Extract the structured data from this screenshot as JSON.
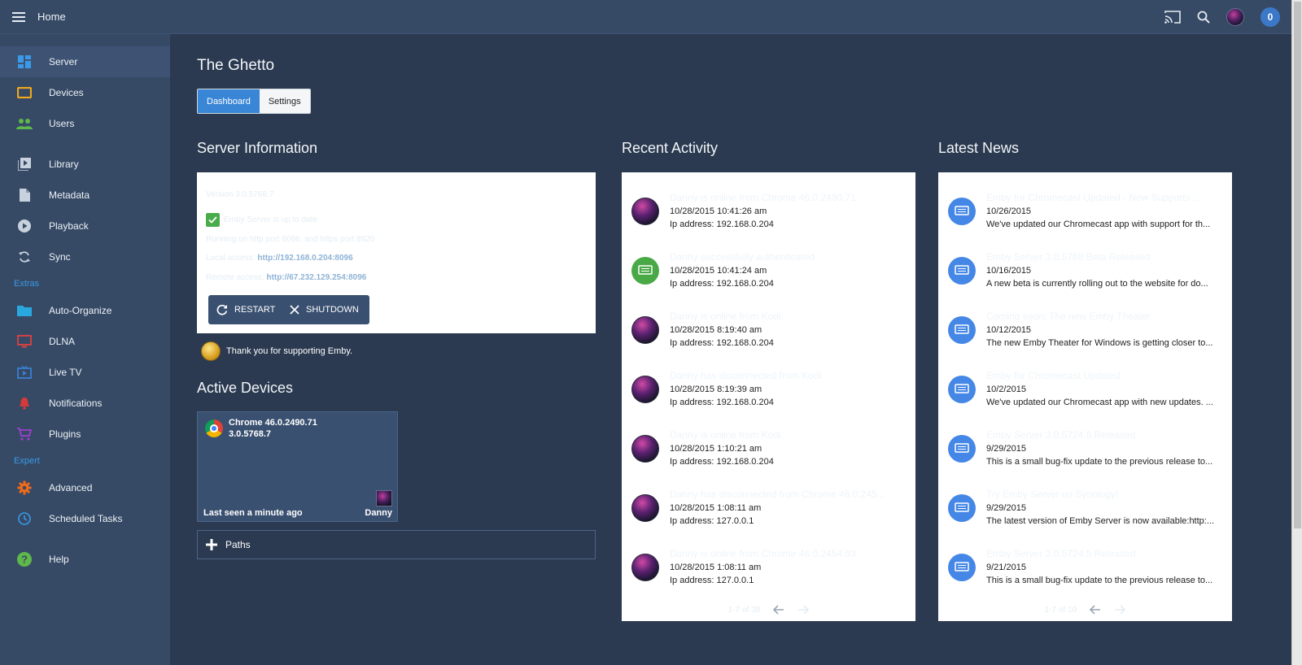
{
  "header": {
    "title": "Home",
    "notification_count": "0"
  },
  "sidebar": {
    "items": [
      {
        "label": "Server",
        "icon": "dashboard-icon",
        "color": "#3a9ae8"
      },
      {
        "label": "Devices",
        "icon": "tablet-icon",
        "color": "#f0a91a"
      },
      {
        "label": "Users",
        "icon": "people-icon",
        "color": "#5fb84a"
      },
      {
        "label": "Library",
        "icon": "video-library-icon",
        "color": "#c8d2de"
      },
      {
        "label": "Metadata",
        "icon": "document-icon",
        "color": "#c8d2de"
      },
      {
        "label": "Playback",
        "icon": "play-circle-icon",
        "color": "#c8d2de"
      },
      {
        "label": "Sync",
        "icon": "sync-icon",
        "color": "#c8d2de"
      },
      {
        "label": "Auto-Organize",
        "icon": "folder-icon",
        "color": "#29a8e0"
      },
      {
        "label": "DLNA",
        "icon": "tv-icon",
        "color": "#e04040"
      },
      {
        "label": "Live TV",
        "icon": "live-tv-icon",
        "color": "#3a7fd4"
      },
      {
        "label": "Notifications",
        "icon": "bell-icon",
        "color": "#d43a3a"
      },
      {
        "label": "Plugins",
        "icon": "cart-icon",
        "color": "#9c3fd0"
      },
      {
        "label": "Advanced",
        "icon": "gear-icon",
        "color": "#f06a1a"
      },
      {
        "label": "Scheduled Tasks",
        "icon": "clock-icon",
        "color": "#3a9ae8"
      },
      {
        "label": "Help",
        "icon": "help-icon",
        "color": "#5fb84a"
      }
    ],
    "sections": {
      "extras": "Extras",
      "expert": "Expert"
    }
  },
  "main": {
    "title": "The Ghetto",
    "tabs": [
      "Dashboard",
      "Settings"
    ],
    "server_info": {
      "heading": "Server Information",
      "version": "Version 3.0.5768.7",
      "status": "Emby Server is up to date",
      "ports": "Running on http port 8096, and https port 8920",
      "local_label": "Local access:",
      "local_url": "http://192.168.0.204:8096",
      "remote_label": "Remote access:",
      "remote_url": "http://67.232.129.254:8096",
      "restart": "RESTART",
      "shutdown": "SHUTDOWN"
    },
    "support_text": "Thank you for supporting Emby.",
    "active_devices": {
      "heading": "Active Devices",
      "device_name": "Chrome 46.0.2490.71",
      "device_version": "3.0.5768.7",
      "last_seen": "Last seen a minute ago",
      "user": "Danny"
    },
    "paths_label": "Paths",
    "recent_activity": {
      "heading": "Recent Activity",
      "items": [
        {
          "title": "Danny is online from Chrome 46.0.2490.71",
          "time": "10/28/2015 10:41:26 am",
          "detail": "Ip address: 192.168.0.204",
          "avatar": "user"
        },
        {
          "title": "Danny successfully authenticated",
          "time": "10/28/2015 10:41:24 am",
          "detail": "Ip address: 192.168.0.204",
          "avatar": "green"
        },
        {
          "title": "Danny is online from Kodi",
          "time": "10/28/2015 8:19:40 am",
          "detail": "Ip address: 192.168.0.204",
          "avatar": "user"
        },
        {
          "title": "Danny has disconnected from Kodi",
          "time": "10/28/2015 8:19:39 am",
          "detail": "Ip address: 192.168.0.204",
          "avatar": "user"
        },
        {
          "title": "Danny is online from Kodi",
          "time": "10/28/2015 1:10:21 am",
          "detail": "Ip address: 192.168.0.204",
          "avatar": "user"
        },
        {
          "title": "Danny has disconnected from Chrome 46.0.245...",
          "time": "10/28/2015 1:08:11 am",
          "detail": "Ip address: 127.0.0.1",
          "avatar": "user"
        },
        {
          "title": "Danny is online from Chrome 46.0.2454.93",
          "time": "10/28/2015 1:08:11 am",
          "detail": "Ip address: 127.0.0.1",
          "avatar": "user"
        }
      ],
      "pager": "1-7 of 38"
    },
    "latest_news": {
      "heading": "Latest News",
      "items": [
        {
          "title": "Emby for Chromecast Updated - Now Supports ...",
          "date": "10/26/2015",
          "summary": "We've updated our Chromecast app with support for th..."
        },
        {
          "title": "Emby Server 3.0.5768 Beta Released",
          "date": "10/16/2015",
          "summary": "A new beta is currently rolling out to the website for do..."
        },
        {
          "title": "Coming soon: The new Emby Theater",
          "date": "10/12/2015",
          "summary": "The new Emby Theater for Windows is getting closer to..."
        },
        {
          "title": "Emby for Chromecast Updated",
          "date": "10/2/2015",
          "summary": "We've updated our Chromecast app with new updates. ..."
        },
        {
          "title": "Emby Server 3.0.5724.6 Released",
          "date": "9/29/2015",
          "summary": "This is a small bug-fix update to the previous release to..."
        },
        {
          "title": "Try Emby Server on Synology!",
          "date": "9/29/2015",
          "summary": "The latest version of Emby Server is now available:http:..."
        },
        {
          "title": "Emby Server 3.0.5724.5 Released",
          "date": "9/21/2015",
          "summary": "This is a small bug-fix update to the previous release to..."
        }
      ],
      "pager": "1-7 of 10"
    }
  }
}
